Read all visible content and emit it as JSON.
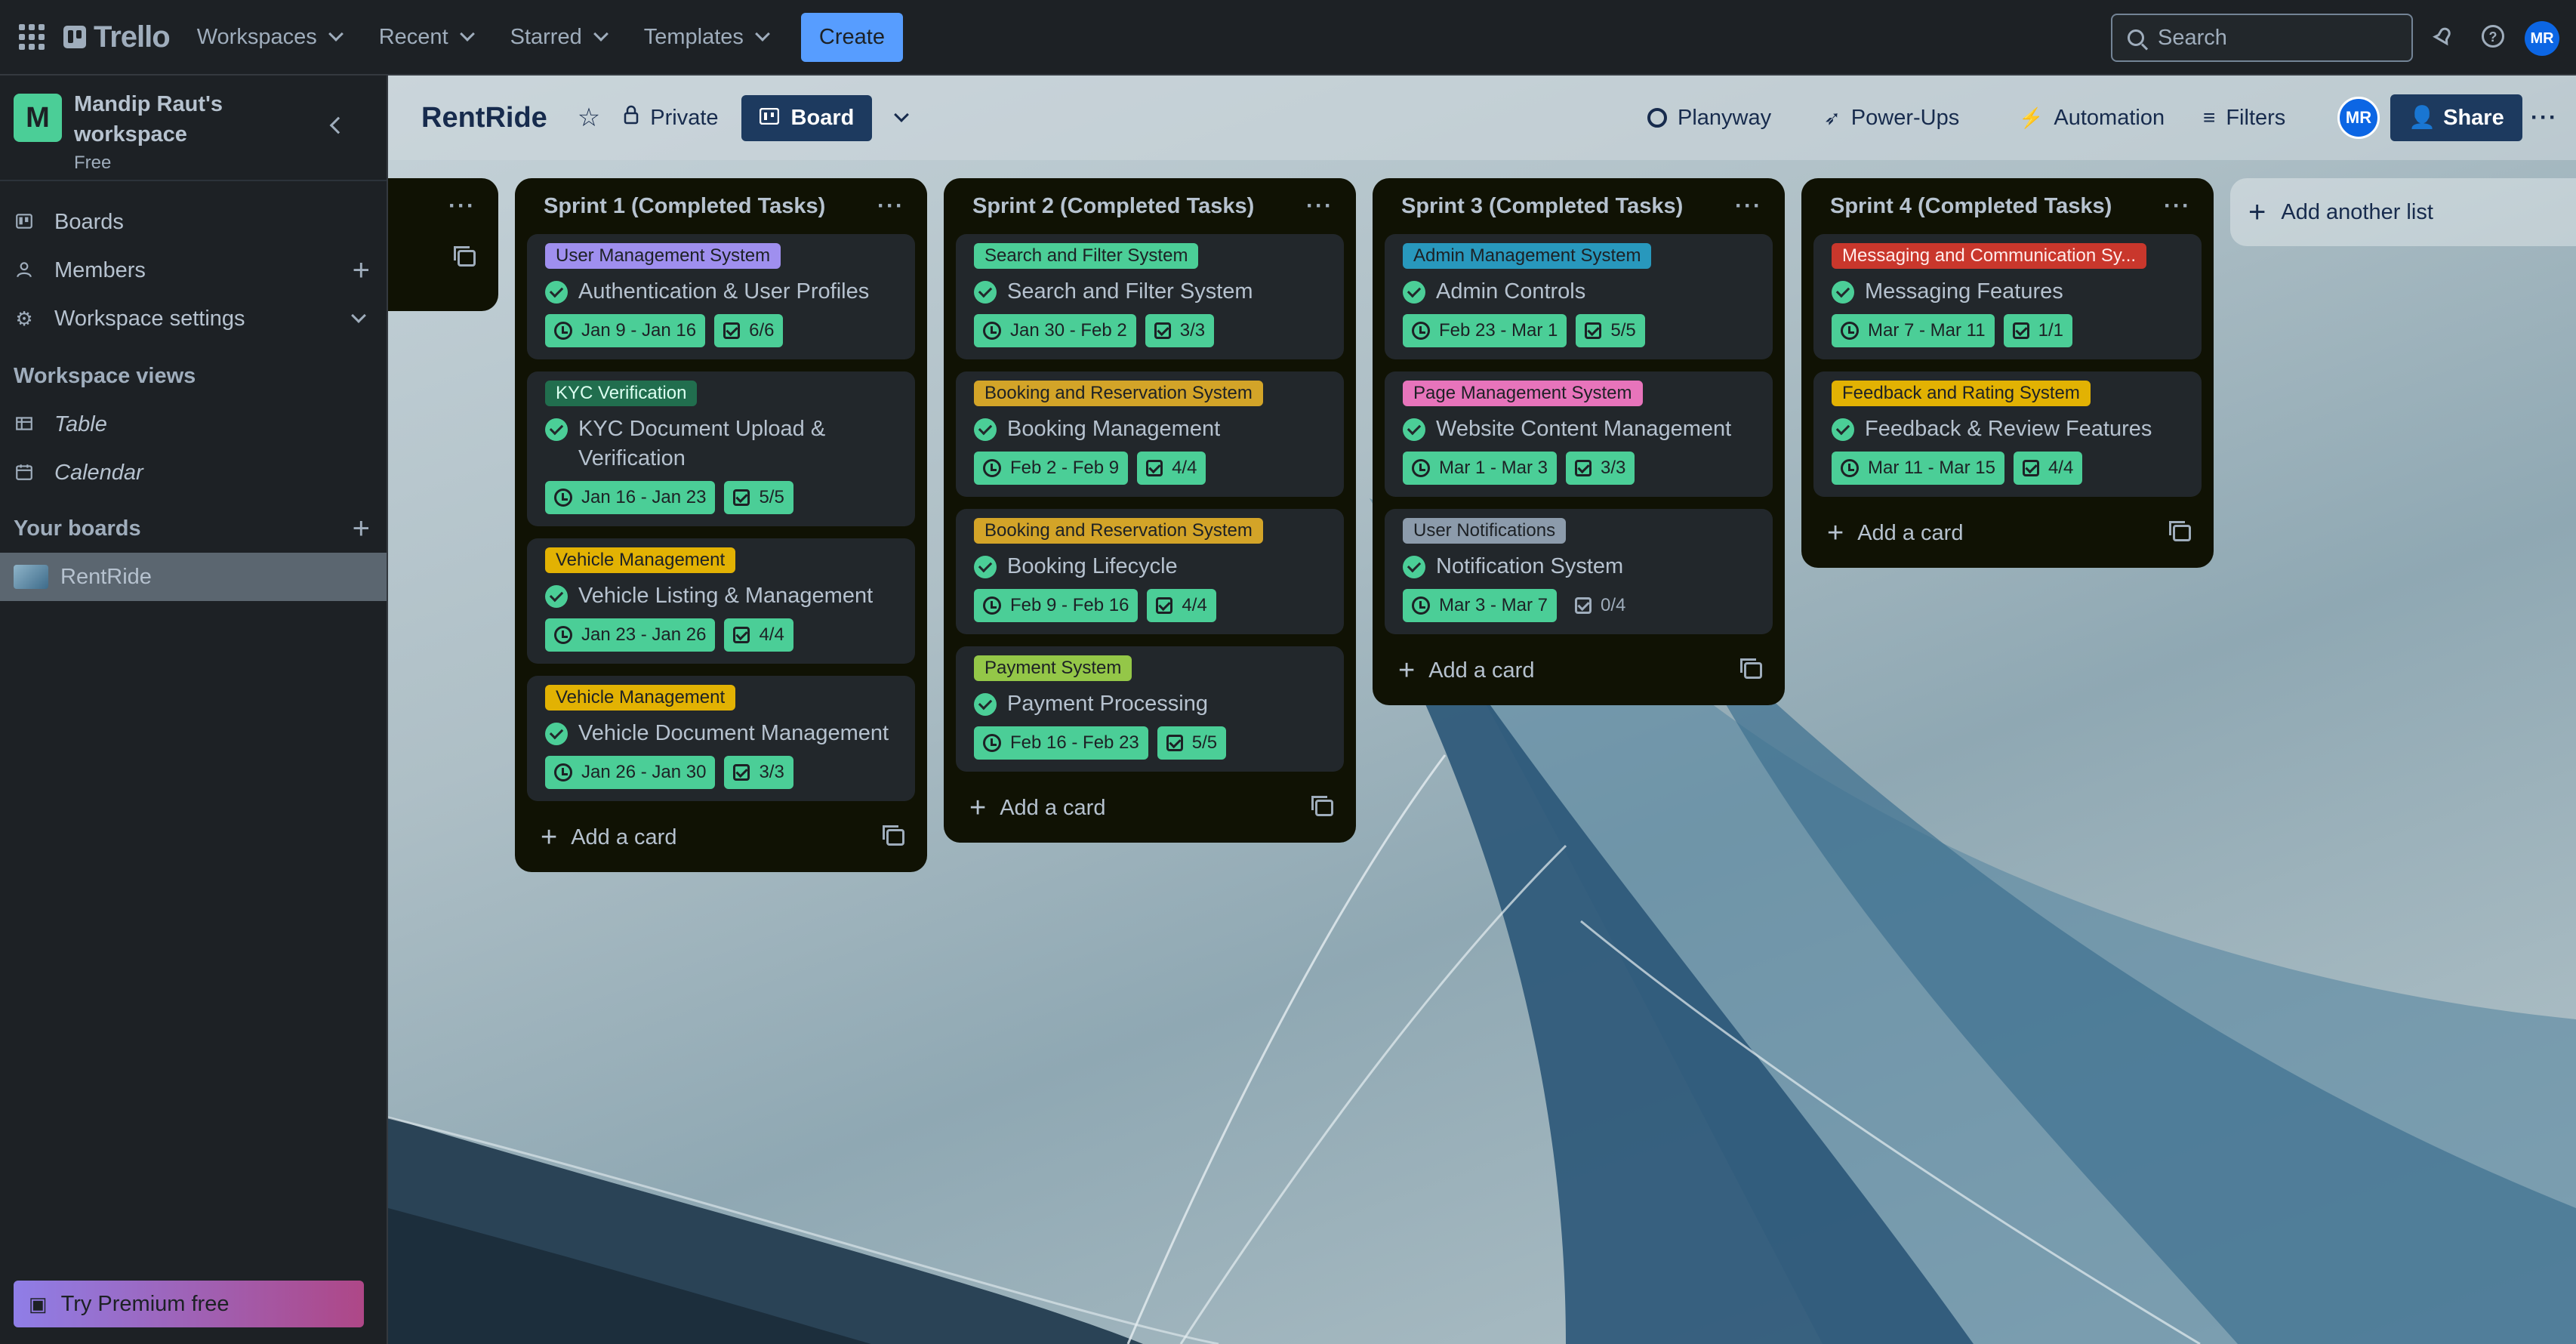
{
  "topnav": {
    "brand": "Trello",
    "menus": [
      "Workspaces",
      "Recent",
      "Starred",
      "Templates"
    ],
    "create_label": "Create",
    "search_placeholder": "Search",
    "avatar_initials": "MR"
  },
  "sidebar": {
    "workspace_initial": "M",
    "workspace_name": "Mandip Raut's workspace",
    "workspace_plan": "Free",
    "items": [
      {
        "label": "Boards",
        "icon": "board-icon"
      },
      {
        "label": "Members",
        "icon": "person-icon"
      },
      {
        "label": "Workspace settings",
        "icon": "gear-icon"
      }
    ],
    "views_heading": "Workspace views",
    "views": [
      {
        "label": "Table",
        "icon": "table-icon"
      },
      {
        "label": "Calendar",
        "icon": "calendar-icon"
      }
    ],
    "boards_heading": "Your boards",
    "boards": [
      {
        "label": "RentRide"
      }
    ],
    "premium_label": "Try Premium free"
  },
  "board": {
    "name": "RentRide",
    "visibility": "Private",
    "view": "Board",
    "right": {
      "planyway": "Planyway",
      "powerups": "Power-Ups",
      "automation": "Automation",
      "filters": "Filters",
      "share": "Share",
      "avatar": "MR"
    },
    "add_list_label": "Add another list",
    "add_card_label": "Add a card",
    "lists": [
      {
        "title": "Sprint 1 (Completed Tasks)",
        "cards": [
          {
            "label": "User Management System",
            "label_color": "#9f8fef",
            "title": "Authentication & User Profiles",
            "dates": "Jan 9 - Jan 16",
            "checklist": "6/6",
            "checklist_done": true
          },
          {
            "label": "KYC Verification",
            "label_color": "#216e4e",
            "label_text_color": "#dcfff1",
            "title": "KYC Document Upload & Verification",
            "dates": "Jan 16 - Jan 23",
            "checklist": "5/5",
            "checklist_done": true
          },
          {
            "label": "Vehicle Management",
            "label_color": "#e2b203",
            "title": "Vehicle Listing & Management",
            "dates": "Jan 23 - Jan 26",
            "checklist": "4/4",
            "checklist_done": true
          },
          {
            "label": "Vehicle Management",
            "label_color": "#e2b203",
            "title": "Vehicle Document Management",
            "dates": "Jan 26 - Jan 30",
            "checklist": "3/3",
            "checklist_done": true
          }
        ]
      },
      {
        "title": "Sprint 2 (Completed Tasks)",
        "cards": [
          {
            "label": "Search and Filter System",
            "label_color": "#4bce97",
            "title": "Search and Filter System",
            "dates": "Jan 30 - Feb 2",
            "checklist": "3/3",
            "checklist_done": true
          },
          {
            "label": "Booking and Reservation System",
            "label_color": "#d3a428",
            "title": "Booking Management",
            "dates": "Feb 2 - Feb 9",
            "checklist": "4/4",
            "checklist_done": true
          },
          {
            "label": "Booking and Reservation System",
            "label_color": "#d3a428",
            "title": "Booking Lifecycle",
            "dates": "Feb 9 - Feb 16",
            "checklist": "4/4",
            "checklist_done": true
          },
          {
            "label": "Payment System",
            "label_color": "#94c748",
            "title": "Payment Processing",
            "dates": "Feb 16 - Feb 23",
            "checklist": "5/5",
            "checklist_done": true
          }
        ]
      },
      {
        "title": "Sprint 3 (Completed Tasks)",
        "cards": [
          {
            "label": "Admin Management System",
            "label_color": "#2898bd",
            "title": "Admin Controls",
            "dates": "Feb 23 - Mar 1",
            "checklist": "5/5",
            "checklist_done": true
          },
          {
            "label": "Page Management System",
            "label_color": "#e774bb",
            "title": "Website Content Management",
            "dates": "Mar 1 - Mar 3",
            "checklist": "3/3",
            "checklist_done": true
          },
          {
            "label": "User Notifications",
            "label_color": "#8c9bab",
            "title": "Notification System",
            "dates": "Mar 3 - Mar 7",
            "checklist": "0/4",
            "checklist_done": false
          }
        ]
      },
      {
        "title": "Sprint 4 (Completed Tasks)",
        "cards": [
          {
            "label": "Messaging and Communication Sy...",
            "label_color": "#c9372c",
            "label_text_color": "#ffeceb",
            "title": "Messaging Features",
            "dates": "Mar 7 - Mar 11",
            "checklist": "1/1",
            "checklist_done": true
          },
          {
            "label": "Feedback and Rating System",
            "label_color": "#e2b203",
            "title": "Feedback & Review Features",
            "dates": "Mar 11 - Mar 15",
            "checklist": "4/4",
            "checklist_done": true
          }
        ]
      }
    ]
  }
}
